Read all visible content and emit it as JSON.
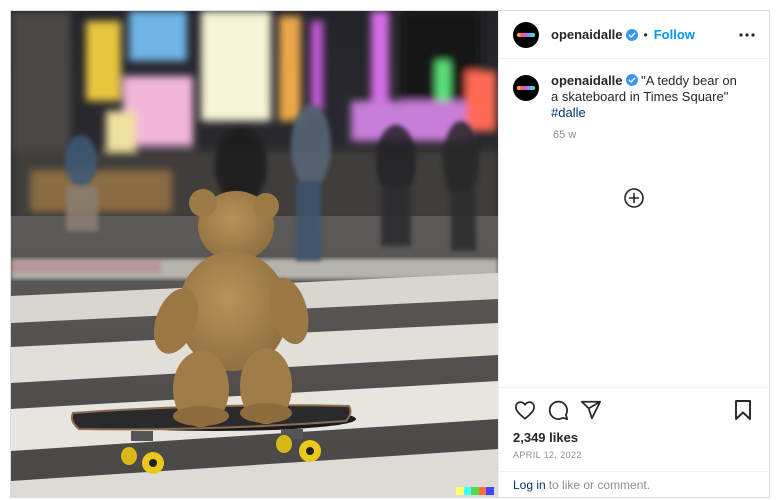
{
  "post": {
    "username": "openaidalle",
    "follow_label": "Follow",
    "separator": "•",
    "caption_text": "\"A teddy bear on a skateboard in Times Square\"",
    "hashtag": "#dalle",
    "time_ago": "65 w",
    "likes": "2,349 likes",
    "date": "APRIL 12, 2022"
  },
  "footer": {
    "login_link": "Log in",
    "login_suffix": "to like or comment."
  },
  "icons": {
    "more": "more-options-icon",
    "verified": "verified-badge-icon",
    "load_more": "plus-circle-icon",
    "like": "heart-icon",
    "comment": "comment-icon",
    "share": "share-icon",
    "save": "bookmark-icon"
  },
  "colors": {
    "follow": "#0095f6",
    "hashtag": "#00376b",
    "muted": "#8e8e8e",
    "verified": "#3897f0"
  }
}
